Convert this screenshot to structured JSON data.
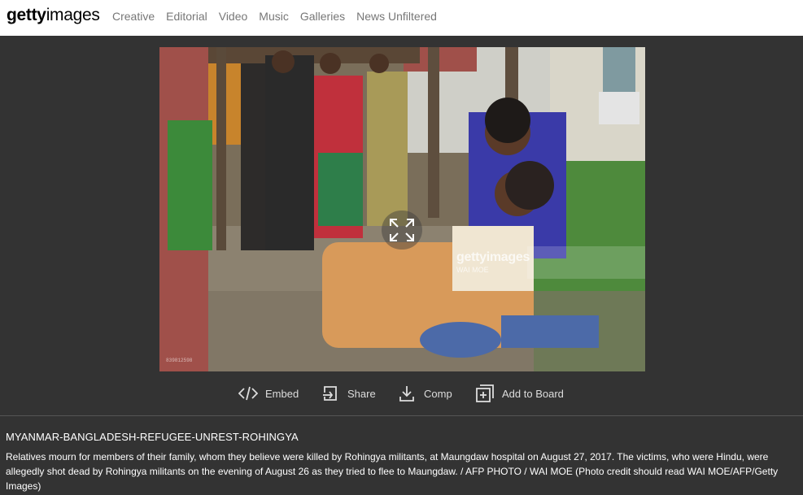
{
  "header": {
    "logo_bold": "getty",
    "logo_light": "images",
    "nav": [
      "Creative",
      "Editorial",
      "Video",
      "Music",
      "Galleries",
      "News Unfiltered"
    ]
  },
  "photo": {
    "watermark": "gettyimages",
    "credit": "WAI MOE",
    "image_id": "839812598"
  },
  "actions": {
    "embed": "Embed",
    "share": "Share",
    "comp": "Comp",
    "board": "Add to Board"
  },
  "caption": {
    "title": "MYANMAR-BANGLADESH-REFUGEE-UNREST-ROHINGYA",
    "text": "Relatives mourn for members of their family, whom they believe were killed by Rohingya militants, at Maungdaw hospital on August 27, 2017. The victims, who were Hindu, were allegedly shot dead by Rohingya militants on the evening of August 26 as they tried to flee to Maungdaw. / AFP PHOTO / WAI MOE (Photo credit should read WAI MOE/AFP/Getty Images)"
  },
  "colors": {
    "page_bg": "#333333",
    "header_bg": "#ffffff",
    "nav_text": "#777777",
    "action_text": "#dddddd"
  }
}
